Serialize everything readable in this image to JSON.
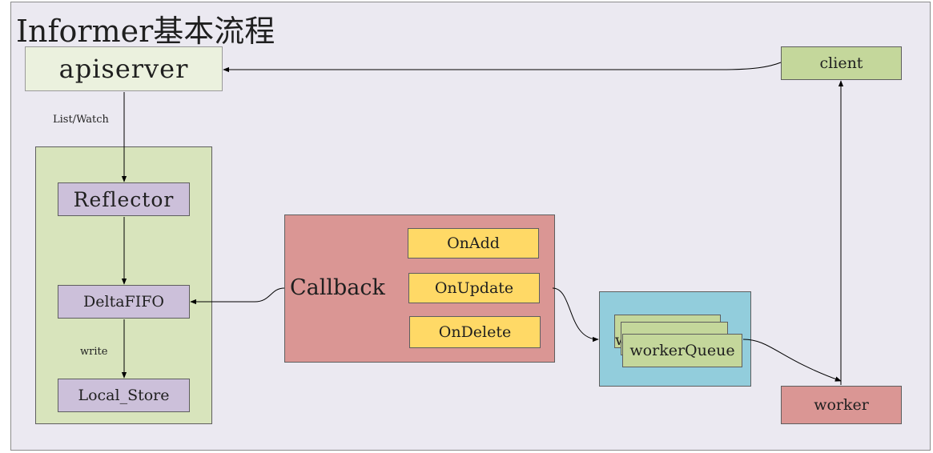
{
  "title": "Informer基本流程",
  "nodes": {
    "apiserver": "apiserver",
    "client": "client",
    "reflector": "Reflector",
    "deltafifo": "DeltaFIFO",
    "local_store": "Local_Store",
    "callback": "Callback",
    "on_add": "OnAdd",
    "on_update": "OnUpdate",
    "on_delete": "OnDelete",
    "worker_queue_back": "workerQueue",
    "worker_queue_middle": "workerQueue",
    "worker_queue": "workerQueue",
    "worker": "worker"
  },
  "edge_labels": {
    "list_watch": "List/Watch",
    "write": "write"
  },
  "colors": {
    "background": "#ebe9f1",
    "apiserver_fill": "#ebf1de",
    "client_fill": "#c4d79b",
    "informer_group_fill": "#d8e4bc",
    "store_fill": "#ccc0da",
    "callback_fill": "#da9694",
    "handler_fill": "#ffd966",
    "queue_group_fill": "#92cddc",
    "queue_fill": "#c4d79b",
    "worker_fill": "#da9694"
  }
}
